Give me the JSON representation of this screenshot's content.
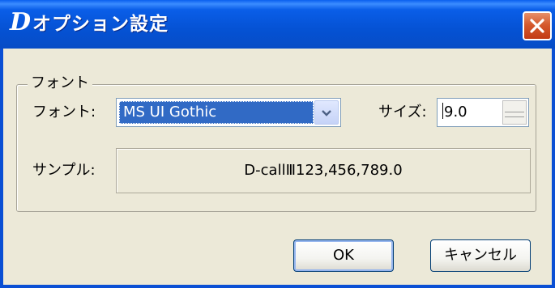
{
  "window": {
    "title": "オプション設定",
    "app_icon_glyph": "D",
    "close_icon": "close-x-icon",
    "colors": {
      "titlebar": "#0552d4",
      "body": "#ece9d8",
      "close": "#d55a2e",
      "selection": "#316ac5"
    }
  },
  "font_group": {
    "legend": "フォント",
    "font_label": "フォント:",
    "font_value": "MS UI Gothic",
    "size_label": "サイズ:",
    "size_value": "9.0",
    "sample_label": "サンプル:",
    "sample_text": "D-callⅢ123,456,789.0"
  },
  "buttons": {
    "ok": "OK",
    "cancel": "キャンセル"
  }
}
